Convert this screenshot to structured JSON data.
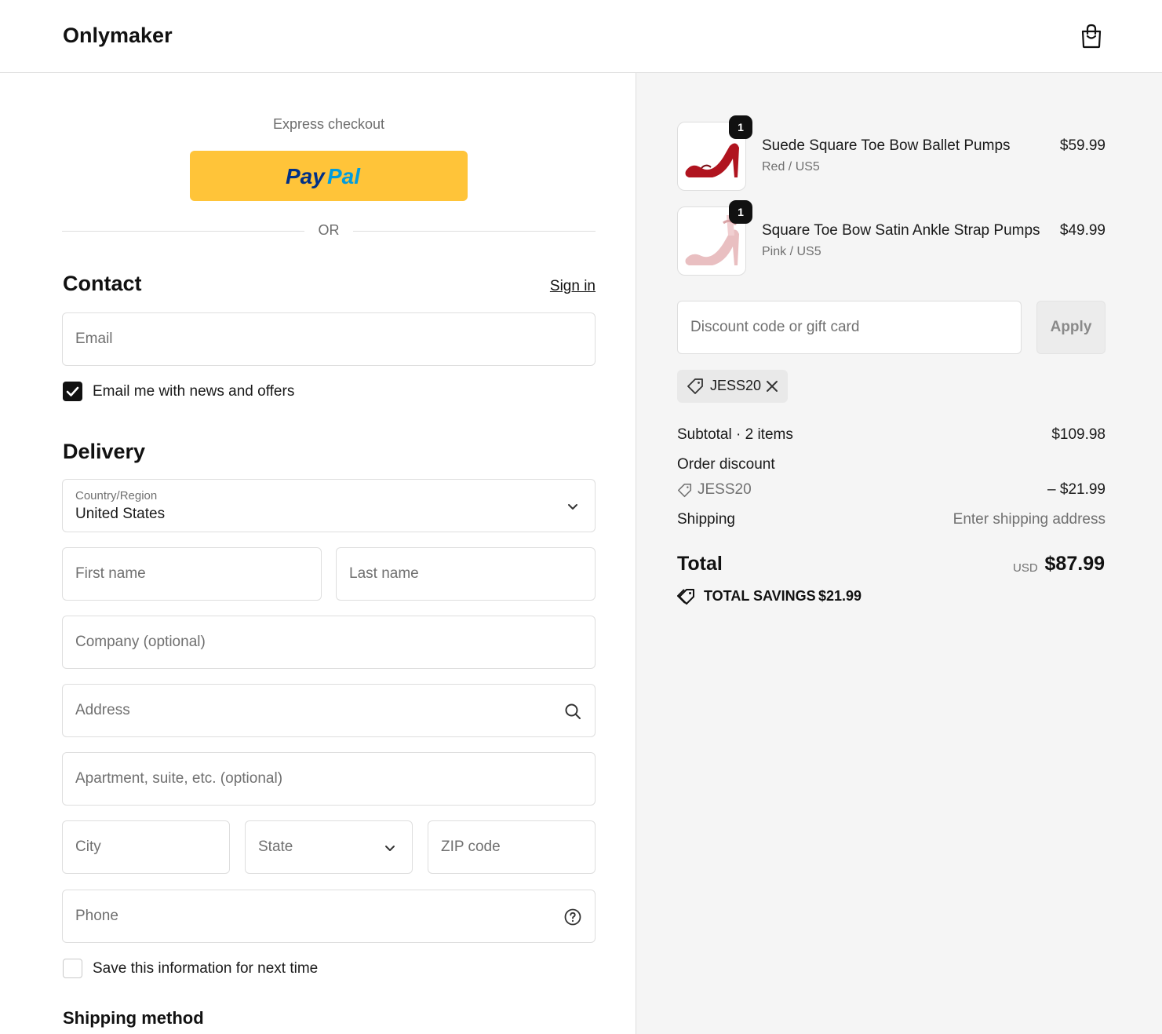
{
  "header": {
    "brand": "Onlymaker"
  },
  "express": {
    "label": "Express checkout",
    "or": "OR"
  },
  "contact": {
    "title": "Contact",
    "signin": "Sign in",
    "email_placeholder": "Email",
    "news_label": "Email me with news and offers",
    "news_checked": true
  },
  "delivery": {
    "title": "Delivery",
    "country_label": "Country/Region",
    "country_value": "United States",
    "first_name": "First name",
    "last_name": "Last name",
    "company": "Company (optional)",
    "address": "Address",
    "apartment": "Apartment, suite, etc. (optional)",
    "city": "City",
    "state": "State",
    "zip": "ZIP code",
    "phone": "Phone",
    "save_label": "Save this information for next time",
    "save_checked": false
  },
  "shipping_method": {
    "title": "Shipping method"
  },
  "cart": {
    "items": [
      {
        "qty": "1",
        "name": "Suede Square Toe Bow Ballet Pumps",
        "variant": "Red / US5",
        "price": "$59.99",
        "color": "#b0141f"
      },
      {
        "qty": "1",
        "name": "Square Toe Bow Satin Ankle Strap Pumps",
        "variant": "Pink / US5",
        "price": "$49.99",
        "color": "#e9bfc1"
      }
    ],
    "discount_placeholder": "Discount code or gift card",
    "apply": "Apply",
    "applied_code": "JESS20"
  },
  "summary": {
    "subtotal_label": "Subtotal · 2 items",
    "subtotal_value": "$109.98",
    "order_discount_label": "Order discount",
    "discount_code": "JESS20",
    "discount_value": "– $21.99",
    "shipping_label": "Shipping",
    "shipping_value": "Enter shipping address",
    "total_label": "Total",
    "currency": "USD",
    "total_value": "$87.99",
    "savings_label": "TOTAL SAVINGS",
    "savings_value": "$21.99"
  },
  "colors": {
    "paypal": "#ffc439",
    "paypal_dark": "#003087",
    "paypal_light": "#009cde",
    "accent": "#111111"
  }
}
